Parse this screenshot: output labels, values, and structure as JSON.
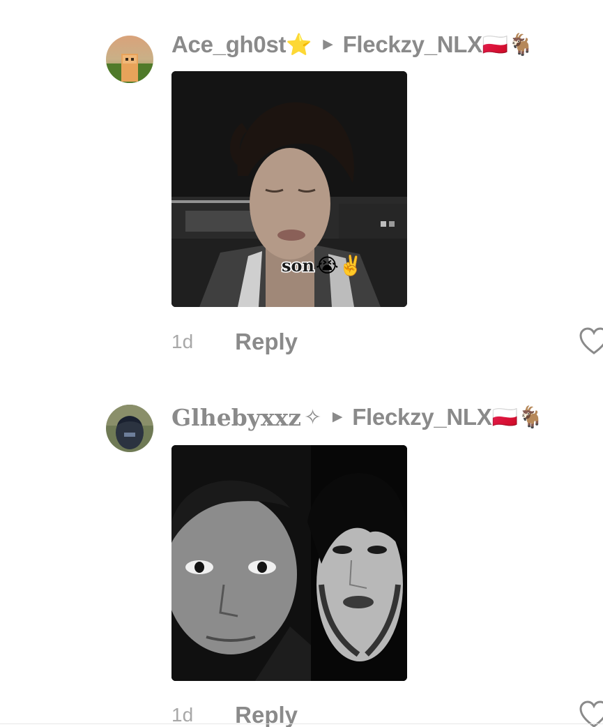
{
  "comments": [
    {
      "username": "Ace_gh0st",
      "username_emoji": "⭐",
      "reply_to": "Fleckzy_NLX",
      "reply_to_emoji": "🇵🇱🐐",
      "media_sticker_text": "son",
      "media_sticker_emoji": "😭✌️",
      "timestamp": "1d",
      "reply_label": "Reply"
    },
    {
      "username": "Glhebyxxz",
      "username_emoji": "✧",
      "reply_to": "Fleckzy_NLX",
      "reply_to_emoji": "🇵🇱🐐",
      "timestamp": "1d",
      "reply_label": "Reply"
    }
  ],
  "icons": {
    "reply_arrow": "triangle-right-icon",
    "like": "heart-outline-icon"
  },
  "colors": {
    "username": "#8a8a8a",
    "meta": "#a8a8a8",
    "background": "#ffffff"
  }
}
